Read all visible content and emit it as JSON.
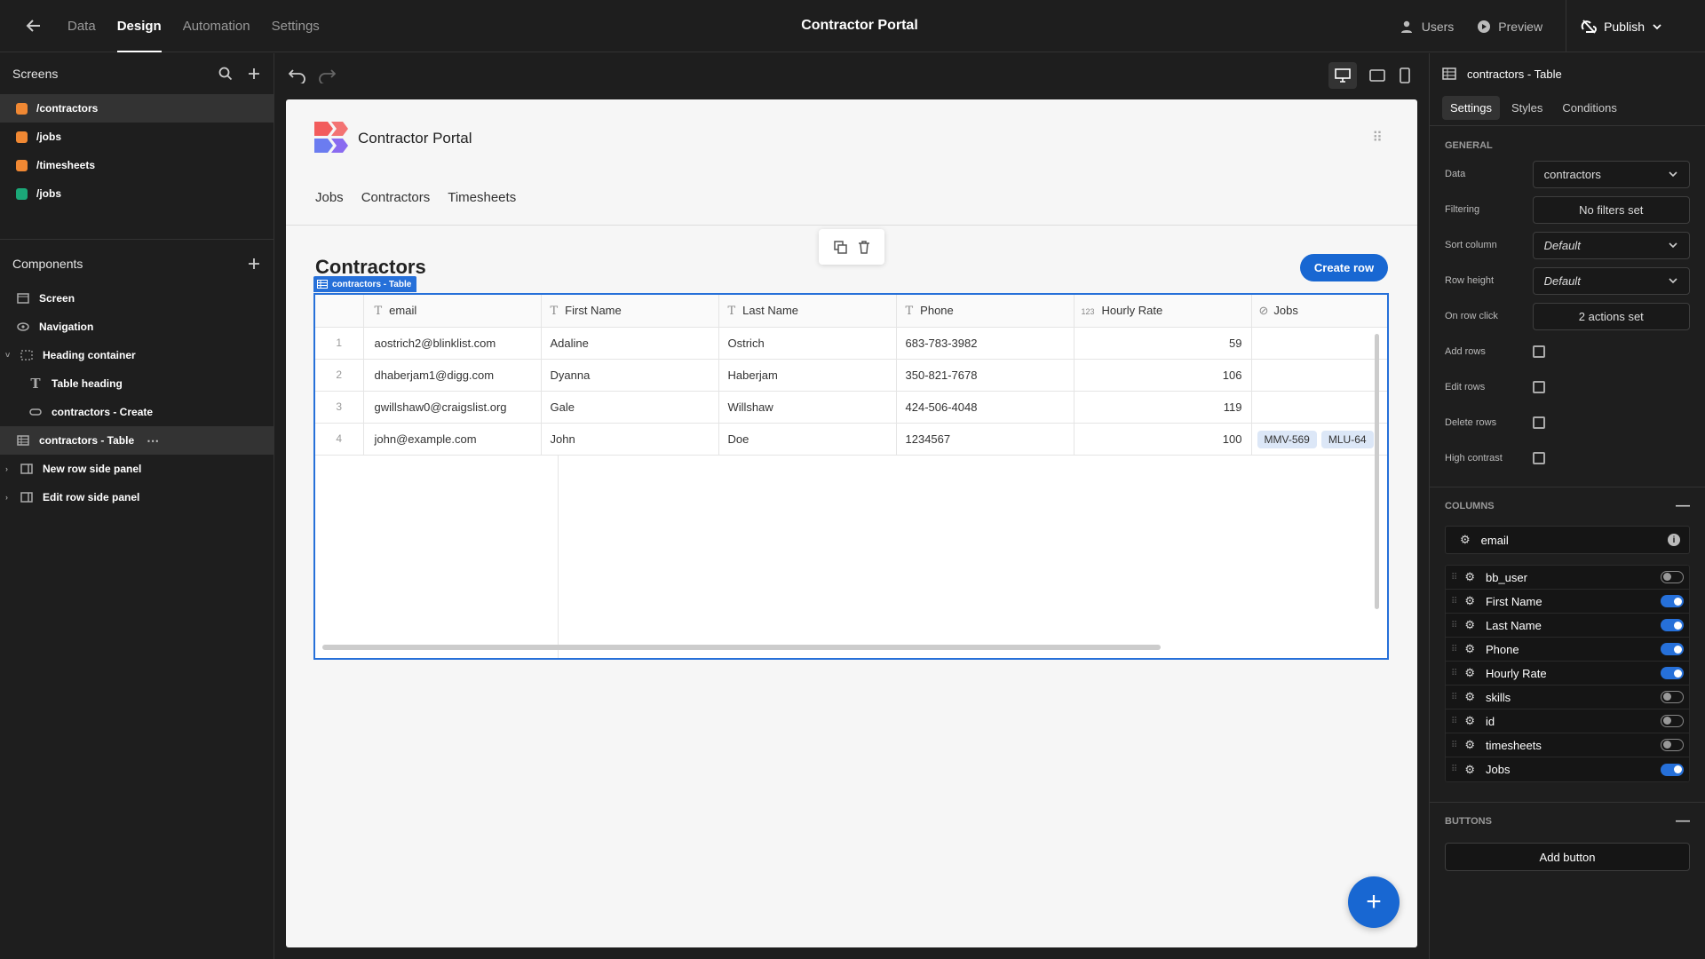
{
  "topbar": {
    "back_icon": "arrow-left-icon",
    "tabs": [
      "Data",
      "Design",
      "Automation",
      "Settings"
    ],
    "app_title": "Contractor Portal",
    "users": "Users",
    "preview": "Preview",
    "publish": "Publish"
  },
  "left": {
    "screens_title": "Screens",
    "screens": [
      {
        "label": "/contractors",
        "color": "#f08833"
      },
      {
        "label": "/jobs",
        "color": "#f08833"
      },
      {
        "label": "/timesheets",
        "color": "#f08833"
      },
      {
        "label": "/jobs",
        "color": "#1ba878"
      }
    ],
    "components_title": "Components",
    "components": [
      "Screen",
      "Navigation",
      "Heading container",
      "Table heading",
      "contractors - Create",
      "contractors - Table",
      "New row side panel",
      "Edit row side panel"
    ]
  },
  "canvas": {
    "app_name": "Contractor Portal",
    "nav": [
      "Jobs",
      "Contractors",
      "Timesheets"
    ],
    "heading": "Contractors",
    "create_row": "Create row",
    "table_tag": "contractors - Table",
    "columns": [
      "email",
      "First Name",
      "Last Name",
      "Phone",
      "Hourly Rate",
      "Jobs"
    ],
    "number_type_badge": "123",
    "rows": [
      {
        "n": "1",
        "email": "aostrich2@blinklist.com",
        "first": "Adaline",
        "last": "Ostrich",
        "phone": "683-783-3982",
        "rate": "59"
      },
      {
        "n": "2",
        "email": "dhaberjam1@digg.com",
        "first": "Dyanna",
        "last": "Haberjam",
        "phone": "350-821-7678",
        "rate": "106"
      },
      {
        "n": "3",
        "email": "gwillshaw0@craigslist.org",
        "first": "Gale",
        "last": "Willshaw",
        "phone": "424-506-4048",
        "rate": "119"
      },
      {
        "n": "4",
        "email": "john@example.com",
        "first": "John",
        "last": "Doe",
        "phone": "1234567",
        "rate": "100"
      }
    ],
    "job_chips": [
      "MMV-569",
      "MLU-64"
    ],
    "fab": "+"
  },
  "right": {
    "title": "contractors - Table",
    "tabs": [
      "Settings",
      "Styles",
      "Conditions"
    ],
    "general": "GENERAL",
    "props": [
      {
        "label": "Data",
        "value": "contractors",
        "type": "select"
      },
      {
        "label": "Filtering",
        "value": "No filters set",
        "type": "button"
      },
      {
        "label": "Sort column",
        "value": "Default",
        "type": "select-italic"
      },
      {
        "label": "Row height",
        "value": "Default",
        "type": "select-italic"
      },
      {
        "label": "On row click",
        "value": "2 actions set",
        "type": "button"
      }
    ],
    "checks": [
      "Add rows",
      "Edit rows",
      "Delete rows",
      "High contrast"
    ],
    "columns_title": "COLUMNS",
    "columns": [
      {
        "label": "bb_user",
        "on": false
      },
      {
        "label": "First Name",
        "on": true
      },
      {
        "label": "Last Name",
        "on": true
      },
      {
        "label": "Phone",
        "on": true
      },
      {
        "label": "Hourly Rate",
        "on": true
      },
      {
        "label": "skills",
        "on": false
      },
      {
        "label": "id",
        "on": false
      },
      {
        "label": "timesheets",
        "on": false
      },
      {
        "label": "Jobs",
        "on": true
      }
    ],
    "email_col": "email",
    "buttons_title": "BUTTONS",
    "add_button": "Add button"
  }
}
